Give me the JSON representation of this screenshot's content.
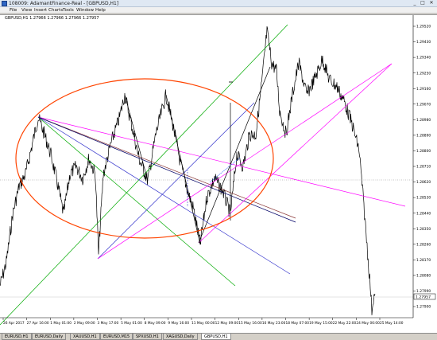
{
  "window": {
    "title": "108009: AdamantFinance-Real - [GBPUSD,H1]",
    "controls": [
      "_",
      "□",
      "✕"
    ]
  },
  "menu": [
    "File",
    "View",
    "Insert",
    "Charts",
    "Tools",
    "Window",
    "Help"
  ],
  "chart": {
    "header": "GBPUSD,H1  1.27966 1.27966 1.27966 1.27957",
    "price_labels": [
      "1.29520",
      "1.29430",
      "1.29340",
      "1.29250",
      "1.29160",
      "1.29070",
      "1.28980",
      "1.28890",
      "1.28800",
      "1.28710",
      "1.28620",
      "1.28530",
      "1.28440",
      "1.28350",
      "1.28260",
      "1.28170",
      "1.28080",
      "1.27990",
      "1.27900"
    ],
    "current_price": "1.27957",
    "time_labels": [
      "26 Apr 2017",
      "27 Apr 16:00",
      "1 May 01:00",
      "2 May 09:00",
      "3 May 17:00",
      "5 May 01:00",
      "8 May 09:00",
      "9 May 16:00",
      "11 May 00:00",
      "12 May 09:00",
      "15 May 16:00",
      "16 May 23:00",
      "18 May 07:00",
      "19 May 15:00",
      "22 May 22:00",
      "24 May 06:00",
      "25 May 14:00"
    ],
    "colors": {
      "candle": "#000000",
      "ellipse": "#ff4400",
      "magenta": "#ff00ff",
      "green": "#00aa00",
      "blue": "#3333cc",
      "brown": "#8b3a3a",
      "navy": "#000066",
      "grid_dot": "#888888"
    }
  },
  "tabs": [
    {
      "label": "EURUSD,H1",
      "active": false
    },
    {
      "label": "EURUSD,Daily",
      "active": false
    },
    {
      "label": "XAUUSD,H1",
      "active": false
    },
    {
      "label": "EURUSD,M15",
      "active": false
    },
    {
      "label": "SPXUSD,H1",
      "active": false
    },
    {
      "label": "XAGUSD,Daily",
      "active": false
    },
    {
      "label": "GBPUSD,H1",
      "active": true
    }
  ]
}
